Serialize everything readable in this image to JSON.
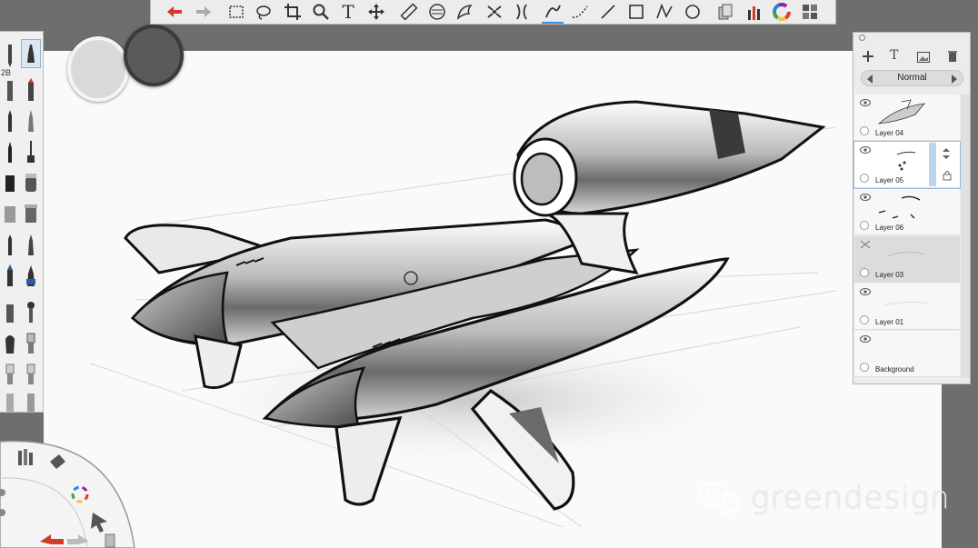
{
  "toolbar": {
    "icons": [
      "undo-icon",
      "redo-icon",
      "rect-select-icon",
      "lasso-icon",
      "crop-icon",
      "zoom-icon",
      "text-tool-icon",
      "move-icon",
      "ruler-icon",
      "ellipse-guide-icon",
      "french-curve-icon",
      "symmetry-icon",
      "distort-icon",
      "pen-icon",
      "curve-icon",
      "line-icon",
      "rectangle-icon",
      "polyline-icon",
      "circle-icon",
      "copy-icon",
      "brushes-icon",
      "color-wheel-icon",
      "layers-icon"
    ],
    "text_tool_label": "T"
  },
  "brush_palette": {
    "labels": [
      "2B"
    ]
  },
  "layers": {
    "blend_mode": "Normal",
    "items": [
      {
        "name": "Layer 04",
        "visible": true,
        "selected": false
      },
      {
        "name": "Layer 05",
        "visible": true,
        "selected": true
      },
      {
        "name": "Layer 06",
        "visible": true,
        "selected": false
      },
      {
        "name": "Layer 03",
        "visible": false,
        "selected": false
      },
      {
        "name": "Layer 01",
        "visible": true,
        "selected": false
      },
      {
        "name": "Background",
        "visible": true,
        "selected": false
      }
    ]
  },
  "watermark": {
    "text": "greendesign"
  },
  "colors": {
    "accent": "#d23a2a",
    "selected_layer_outline": "#9bbbd6",
    "canvas": "#fafafa",
    "background": "#6e6e6e"
  }
}
